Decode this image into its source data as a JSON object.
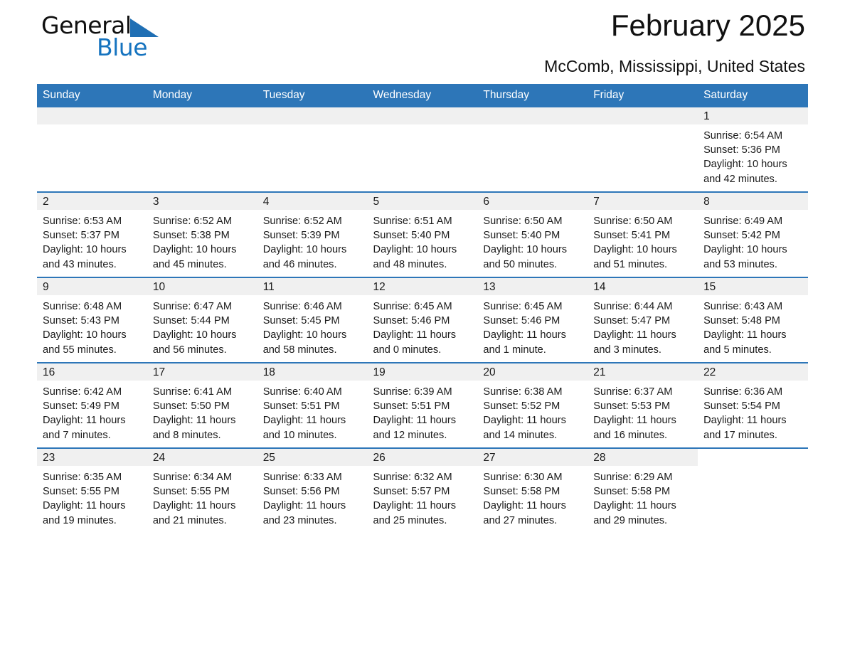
{
  "brand": {
    "name_part1": "General",
    "name_part2": "Blue",
    "triangle_color": "#1f6fb4",
    "blue_color": "#1573bf"
  },
  "header": {
    "title": "February 2025",
    "location": "McComb, Mississippi, United States"
  },
  "theme": {
    "header_blue": "#2d76b8",
    "daynum_band": "#f0f0f0",
    "text": "#1a1a1a"
  },
  "calendar": {
    "weekday_headers": [
      "Sunday",
      "Monday",
      "Tuesday",
      "Wednesday",
      "Thursday",
      "Friday",
      "Saturday"
    ],
    "weeks": [
      [
        {
          "day": "",
          "sunrise": "",
          "sunset": "",
          "daylight_line1": "",
          "daylight_line2": ""
        },
        {
          "day": "",
          "sunrise": "",
          "sunset": "",
          "daylight_line1": "",
          "daylight_line2": ""
        },
        {
          "day": "",
          "sunrise": "",
          "sunset": "",
          "daylight_line1": "",
          "daylight_line2": ""
        },
        {
          "day": "",
          "sunrise": "",
          "sunset": "",
          "daylight_line1": "",
          "daylight_line2": ""
        },
        {
          "day": "",
          "sunrise": "",
          "sunset": "",
          "daylight_line1": "",
          "daylight_line2": ""
        },
        {
          "day": "",
          "sunrise": "",
          "sunset": "",
          "daylight_line1": "",
          "daylight_line2": ""
        },
        {
          "day": "1",
          "sunrise": "Sunrise: 6:54 AM",
          "sunset": "Sunset: 5:36 PM",
          "daylight_line1": "Daylight: 10 hours",
          "daylight_line2": "and 42 minutes."
        }
      ],
      [
        {
          "day": "2",
          "sunrise": "Sunrise: 6:53 AM",
          "sunset": "Sunset: 5:37 PM",
          "daylight_line1": "Daylight: 10 hours",
          "daylight_line2": "and 43 minutes."
        },
        {
          "day": "3",
          "sunrise": "Sunrise: 6:52 AM",
          "sunset": "Sunset: 5:38 PM",
          "daylight_line1": "Daylight: 10 hours",
          "daylight_line2": "and 45 minutes."
        },
        {
          "day": "4",
          "sunrise": "Sunrise: 6:52 AM",
          "sunset": "Sunset: 5:39 PM",
          "daylight_line1": "Daylight: 10 hours",
          "daylight_line2": "and 46 minutes."
        },
        {
          "day": "5",
          "sunrise": "Sunrise: 6:51 AM",
          "sunset": "Sunset: 5:40 PM",
          "daylight_line1": "Daylight: 10 hours",
          "daylight_line2": "and 48 minutes."
        },
        {
          "day": "6",
          "sunrise": "Sunrise: 6:50 AM",
          "sunset": "Sunset: 5:40 PM",
          "daylight_line1": "Daylight: 10 hours",
          "daylight_line2": "and 50 minutes."
        },
        {
          "day": "7",
          "sunrise": "Sunrise: 6:50 AM",
          "sunset": "Sunset: 5:41 PM",
          "daylight_line1": "Daylight: 10 hours",
          "daylight_line2": "and 51 minutes."
        },
        {
          "day": "8",
          "sunrise": "Sunrise: 6:49 AM",
          "sunset": "Sunset: 5:42 PM",
          "daylight_line1": "Daylight: 10 hours",
          "daylight_line2": "and 53 minutes."
        }
      ],
      [
        {
          "day": "9",
          "sunrise": "Sunrise: 6:48 AM",
          "sunset": "Sunset: 5:43 PM",
          "daylight_line1": "Daylight: 10 hours",
          "daylight_line2": "and 55 minutes."
        },
        {
          "day": "10",
          "sunrise": "Sunrise: 6:47 AM",
          "sunset": "Sunset: 5:44 PM",
          "daylight_line1": "Daylight: 10 hours",
          "daylight_line2": "and 56 minutes."
        },
        {
          "day": "11",
          "sunrise": "Sunrise: 6:46 AM",
          "sunset": "Sunset: 5:45 PM",
          "daylight_line1": "Daylight: 10 hours",
          "daylight_line2": "and 58 minutes."
        },
        {
          "day": "12",
          "sunrise": "Sunrise: 6:45 AM",
          "sunset": "Sunset: 5:46 PM",
          "daylight_line1": "Daylight: 11 hours",
          "daylight_line2": "and 0 minutes."
        },
        {
          "day": "13",
          "sunrise": "Sunrise: 6:45 AM",
          "sunset": "Sunset: 5:46 PM",
          "daylight_line1": "Daylight: 11 hours",
          "daylight_line2": "and 1 minute."
        },
        {
          "day": "14",
          "sunrise": "Sunrise: 6:44 AM",
          "sunset": "Sunset: 5:47 PM",
          "daylight_line1": "Daylight: 11 hours",
          "daylight_line2": "and 3 minutes."
        },
        {
          "day": "15",
          "sunrise": "Sunrise: 6:43 AM",
          "sunset": "Sunset: 5:48 PM",
          "daylight_line1": "Daylight: 11 hours",
          "daylight_line2": "and 5 minutes."
        }
      ],
      [
        {
          "day": "16",
          "sunrise": "Sunrise: 6:42 AM",
          "sunset": "Sunset: 5:49 PM",
          "daylight_line1": "Daylight: 11 hours",
          "daylight_line2": "and 7 minutes."
        },
        {
          "day": "17",
          "sunrise": "Sunrise: 6:41 AM",
          "sunset": "Sunset: 5:50 PM",
          "daylight_line1": "Daylight: 11 hours",
          "daylight_line2": "and 8 minutes."
        },
        {
          "day": "18",
          "sunrise": "Sunrise: 6:40 AM",
          "sunset": "Sunset: 5:51 PM",
          "daylight_line1": "Daylight: 11 hours",
          "daylight_line2": "and 10 minutes."
        },
        {
          "day": "19",
          "sunrise": "Sunrise: 6:39 AM",
          "sunset": "Sunset: 5:51 PM",
          "daylight_line1": "Daylight: 11 hours",
          "daylight_line2": "and 12 minutes."
        },
        {
          "day": "20",
          "sunrise": "Sunrise: 6:38 AM",
          "sunset": "Sunset: 5:52 PM",
          "daylight_line1": "Daylight: 11 hours",
          "daylight_line2": "and 14 minutes."
        },
        {
          "day": "21",
          "sunrise": "Sunrise: 6:37 AM",
          "sunset": "Sunset: 5:53 PM",
          "daylight_line1": "Daylight: 11 hours",
          "daylight_line2": "and 16 minutes."
        },
        {
          "day": "22",
          "sunrise": "Sunrise: 6:36 AM",
          "sunset": "Sunset: 5:54 PM",
          "daylight_line1": "Daylight: 11 hours",
          "daylight_line2": "and 17 minutes."
        }
      ],
      [
        {
          "day": "23",
          "sunrise": "Sunrise: 6:35 AM",
          "sunset": "Sunset: 5:55 PM",
          "daylight_line1": "Daylight: 11 hours",
          "daylight_line2": "and 19 minutes."
        },
        {
          "day": "24",
          "sunrise": "Sunrise: 6:34 AM",
          "sunset": "Sunset: 5:55 PM",
          "daylight_line1": "Daylight: 11 hours",
          "daylight_line2": "and 21 minutes."
        },
        {
          "day": "25",
          "sunrise": "Sunrise: 6:33 AM",
          "sunset": "Sunset: 5:56 PM",
          "daylight_line1": "Daylight: 11 hours",
          "daylight_line2": "and 23 minutes."
        },
        {
          "day": "26",
          "sunrise": "Sunrise: 6:32 AM",
          "sunset": "Sunset: 5:57 PM",
          "daylight_line1": "Daylight: 11 hours",
          "daylight_line2": "and 25 minutes."
        },
        {
          "day": "27",
          "sunrise": "Sunrise: 6:30 AM",
          "sunset": "Sunset: 5:58 PM",
          "daylight_line1": "Daylight: 11 hours",
          "daylight_line2": "and 27 minutes."
        },
        {
          "day": "28",
          "sunrise": "Sunrise: 6:29 AM",
          "sunset": "Sunset: 5:58 PM",
          "daylight_line1": "Daylight: 11 hours",
          "daylight_line2": "and 29 minutes."
        },
        {
          "day": "",
          "sunrise": "",
          "sunset": "",
          "daylight_line1": "",
          "daylight_line2": ""
        }
      ]
    ]
  }
}
